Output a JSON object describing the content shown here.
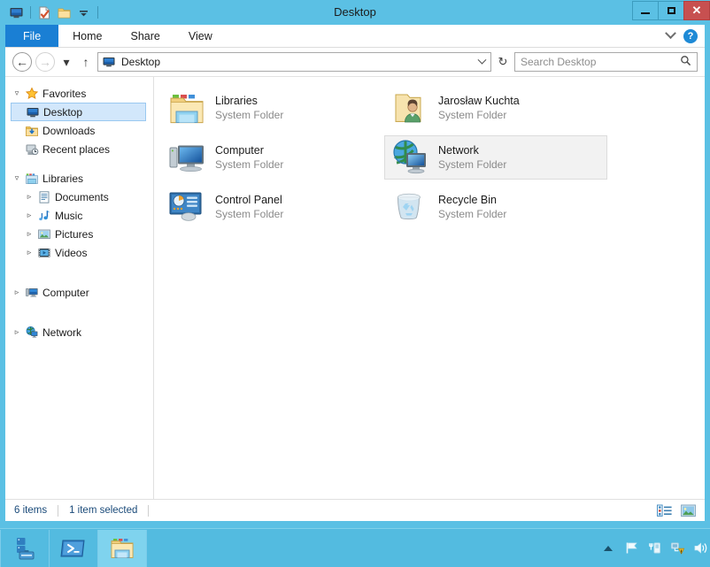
{
  "window": {
    "title": "Desktop",
    "quick_access": [
      {
        "name": "monitor-icon",
        "label": "Desktop"
      },
      {
        "name": "properties-icon",
        "label": "Properties"
      },
      {
        "name": "new-folder-icon",
        "label": "New folder"
      },
      {
        "name": "customize-dropdown-icon",
        "label": "Customize Quick Access Toolbar"
      }
    ],
    "controls": {
      "minimize": "–",
      "maximize": "□",
      "close": "✕"
    }
  },
  "ribbon": {
    "tabs": [
      {
        "label": "File",
        "active": true
      },
      {
        "label": "Home",
        "active": false
      },
      {
        "label": "Share",
        "active": false
      },
      {
        "label": "View",
        "active": false
      }
    ],
    "collapse_icon": "chevron-down-icon",
    "help_label": "?"
  },
  "address": {
    "back_glyph": "←",
    "forward_glyph": "→",
    "history_glyph": "▾",
    "up_glyph": "↑",
    "path": "Desktop",
    "dropdown_glyph": "▾",
    "refresh_glyph": "↻"
  },
  "search": {
    "placeholder": "Search Desktop",
    "icon": "search-icon"
  },
  "navpane": {
    "groups": [
      {
        "name": "Favorites",
        "expanded": true,
        "icon": "star-icon",
        "children": [
          {
            "label": "Desktop",
            "icon": "monitor-icon",
            "selected": true,
            "expandable": false
          },
          {
            "label": "Downloads",
            "icon": "downloads-folder-icon",
            "selected": false,
            "expandable": false
          },
          {
            "label": "Recent places",
            "icon": "recent-places-icon",
            "selected": false,
            "expandable": false
          }
        ]
      },
      {
        "name": "Libraries",
        "expanded": true,
        "icon": "libraries-icon",
        "children": [
          {
            "label": "Documents",
            "icon": "documents-icon",
            "selected": false,
            "expandable": true
          },
          {
            "label": "Music",
            "icon": "music-icon",
            "selected": false,
            "expandable": true
          },
          {
            "label": "Pictures",
            "icon": "pictures-icon",
            "selected": false,
            "expandable": true
          },
          {
            "label": "Videos",
            "icon": "videos-icon",
            "selected": false,
            "expandable": true
          }
        ]
      },
      {
        "name": "Computer",
        "expanded": false,
        "icon": "computer-icon",
        "children": []
      },
      {
        "name": "Network",
        "expanded": false,
        "icon": "network-icon",
        "children": []
      }
    ]
  },
  "content": {
    "items": [
      {
        "name": "Libraries",
        "subtitle": "System Folder",
        "icon": "libraries-folder-icon",
        "selected": false
      },
      {
        "name": "Jarosław Kuchta",
        "subtitle": "System Folder",
        "icon": "user-folder-icon",
        "selected": false
      },
      {
        "name": "Computer",
        "subtitle": "System Folder",
        "icon": "computer-icon",
        "selected": false
      },
      {
        "name": "Network",
        "subtitle": "System Folder",
        "icon": "network-globe-icon",
        "selected": true
      },
      {
        "name": "Control Panel",
        "subtitle": "System Folder",
        "icon": "control-panel-icon",
        "selected": false
      },
      {
        "name": "Recycle Bin",
        "subtitle": "System Folder",
        "icon": "recycle-bin-icon",
        "selected": false
      }
    ]
  },
  "statusbar": {
    "item_count": "6 items",
    "selection": "1 item selected",
    "views": [
      {
        "name": "details-view-button",
        "label": "Details view"
      },
      {
        "name": "large-icons-view-button",
        "label": "Large icons view"
      }
    ]
  },
  "taskbar": {
    "buttons": [
      {
        "name": "server-manager-taskbar-button",
        "label": "Server Manager",
        "active": false
      },
      {
        "name": "powershell-taskbar-button",
        "label": "Windows PowerShell",
        "active": false
      },
      {
        "name": "file-explorer-taskbar-button",
        "label": "File Explorer",
        "active": true
      }
    ],
    "tray": [
      {
        "name": "show-hidden-icons-button",
        "label": "Show hidden icons"
      },
      {
        "name": "action-center-flag-icon",
        "label": "Action Center"
      },
      {
        "name": "usb-eject-icon",
        "label": "Safely Remove Hardware"
      },
      {
        "name": "network-warning-icon",
        "label": "Network - no Internet access"
      },
      {
        "name": "volume-icon",
        "label": "Volume"
      }
    ]
  },
  "colors": {
    "title_bar": "#5bc0e4",
    "file_tab": "#1a7fd4",
    "close_button": "#c75050",
    "selection_tree": "#d2e7fb",
    "selection_item": "#f2f2f2",
    "taskbar": "#53bbe0",
    "status_text": "#1b4b7a"
  }
}
